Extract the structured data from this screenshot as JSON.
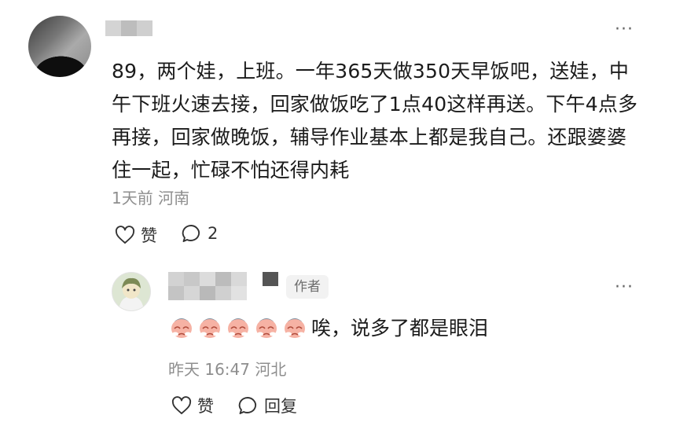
{
  "main_comment": {
    "text": "89，两个娃，上班。一年365天做350天早饭吧，送娃，中午下班火速去接，回家做饭吃了1点40这样再送。下午4点多再接，回家做晚饭，辅导作业基本上都是我自己。还跟婆婆住一起，忙碌不怕还得内耗",
    "meta": "1天前 河南",
    "like_label": "赞",
    "comment_count": "2",
    "more": "···"
  },
  "reply": {
    "author_tag": "作者",
    "emoji_count": 5,
    "text": "唉，说多了都是眼泪",
    "meta": "昨天 16:47 河北",
    "like_label": "赞",
    "reply_label": "回复",
    "more": "···"
  },
  "icons": [
    "heart-icon",
    "comment-bubble-icon",
    "more-icon",
    "crying-emoji-icon"
  ],
  "colors": {
    "meta_gray": "#8e8e8e",
    "text": "#1b1b1b",
    "tag_bg": "#f2f2f2"
  }
}
